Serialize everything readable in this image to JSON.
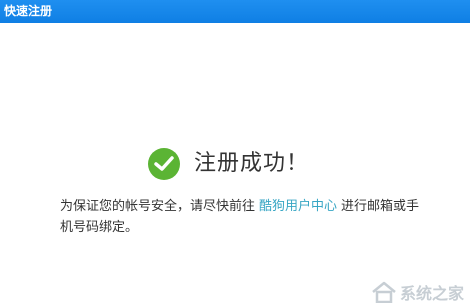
{
  "window": {
    "title": "快速注册"
  },
  "success": {
    "icon": "check-circle-icon",
    "icon_color": "#5bb434",
    "text": "注册成功！"
  },
  "message": {
    "before_link": "为保证您的帐号安全，请尽快前往",
    "link_text": "酷狗用户中心",
    "after_link": "进行邮箱或手机号码绑定。",
    "link_color": "#38a6c4"
  },
  "watermark": {
    "logo_icon": "house-logo-icon",
    "text": "系统之家"
  }
}
